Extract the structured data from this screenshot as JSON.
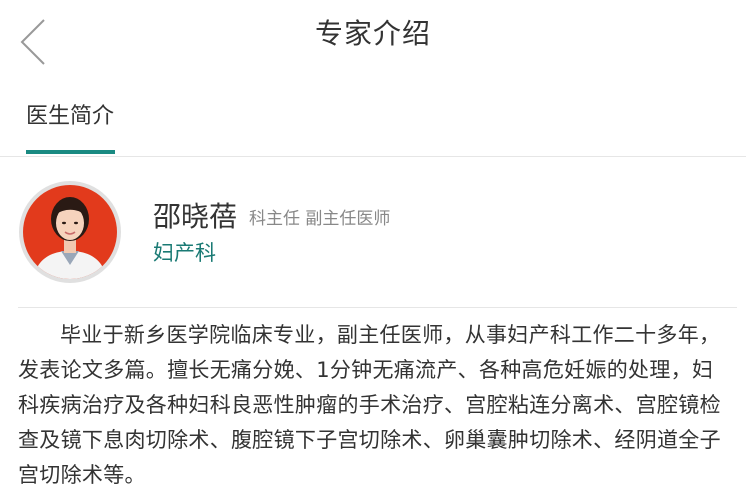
{
  "header": {
    "title": "专家介绍",
    "back_icon": "chevron-left-icon"
  },
  "tabs": [
    {
      "label": "医生简介",
      "active": true
    }
  ],
  "colors": {
    "accent": "#1a8a82",
    "dept_text": "#1a7a74",
    "avatar_bg": "#e23a1c"
  },
  "doctor": {
    "name": "邵晓蓓",
    "title": "科主任 副主任医师",
    "department": "妇产科",
    "bio": "毕业于新乡医学院临床专业，副主任医师，从事妇产科工作二十多年，发表论文多篇。擅长无痛分娩、1分钟无痛流产、各种高危妊娠的处理，妇科疾病治疗及各种妇科良恶性肿瘤的手术治疗、宫腔粘连分离术、宫腔镜检查及镜下息肉切除术、腹腔镜下子宫切除术、卵巢囊肿切除术、经阴道全子宫切除术等。"
  }
}
